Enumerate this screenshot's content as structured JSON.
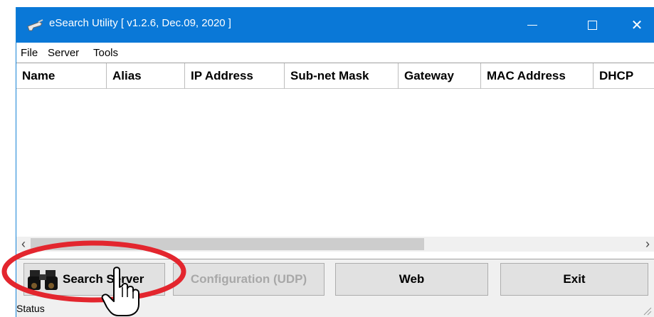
{
  "window": {
    "title": "eSearch Utility [ v1.2.6, Dec.09, 2020 ]",
    "icon": "app-gun-icon",
    "controls": {
      "minimize": "minimize-icon",
      "maximize": "maximize-icon",
      "close_glyph": "✕"
    }
  },
  "menu": {
    "items": [
      "File",
      "Server",
      "Tools"
    ]
  },
  "table": {
    "columns": [
      "Name",
      "Alias",
      "IP Address",
      "Sub-net Mask",
      "Gateway",
      "MAC Address",
      "DHCP"
    ],
    "rows": []
  },
  "scrollbar": {
    "left_arrow": "‹",
    "right_arrow": "›"
  },
  "buttons": {
    "search": "Search Server",
    "search_icon": "binoculars-icon",
    "configuration": "Configuration (UDP)",
    "web": "Web",
    "exit": "Exit"
  },
  "status": {
    "text": "Status"
  },
  "colors": {
    "titlebar": "#0a78d7",
    "highlight": "#e3262e"
  }
}
